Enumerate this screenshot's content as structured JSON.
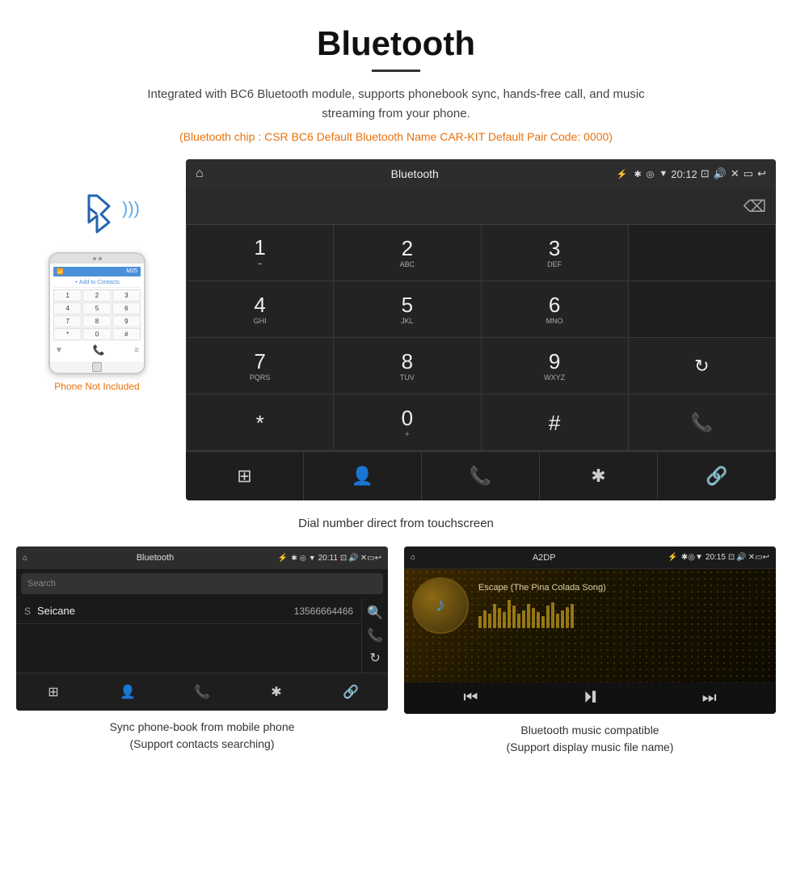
{
  "header": {
    "title": "Bluetooth",
    "subtitle": "Integrated with BC6 Bluetooth module, supports phonebook sync, hands-free call, and music streaming from your phone.",
    "info": "(Bluetooth chip : CSR BC6    Default Bluetooth Name CAR-KIT    Default Pair Code: 0000)"
  },
  "phone_label": "Phone Not Included",
  "dialpad": {
    "screen_title": "Bluetooth",
    "status_time": "20:12",
    "keys": [
      {
        "num": "1",
        "letters": "⌁"
      },
      {
        "num": "2",
        "letters": "ABC"
      },
      {
        "num": "3",
        "letters": "DEF"
      },
      {
        "num": "",
        "letters": "",
        "empty": true
      },
      {
        "num": "4",
        "letters": "GHI"
      },
      {
        "num": "5",
        "letters": "JKL"
      },
      {
        "num": "6",
        "letters": "MNO"
      },
      {
        "num": "",
        "letters": "",
        "empty": true
      },
      {
        "num": "7",
        "letters": "PQRS"
      },
      {
        "num": "8",
        "letters": "TUV"
      },
      {
        "num": "9",
        "letters": "WXYZ"
      },
      {
        "num": "",
        "letters": "reload",
        "special": "reload"
      },
      {
        "num": "*",
        "letters": ""
      },
      {
        "num": "0",
        "letters": "+"
      },
      {
        "num": "#",
        "letters": ""
      },
      {
        "num": "",
        "letters": "call",
        "special": "green_call"
      }
    ],
    "bottom_icons": [
      "grid",
      "person",
      "phone",
      "bluetooth",
      "link"
    ]
  },
  "caption_dial": "Dial number direct from touchscreen",
  "phonebook": {
    "screen_title": "Bluetooth",
    "status_time": "20:11",
    "search_placeholder": "Search",
    "contact_name": "Seicane",
    "contact_number": "13566664466",
    "contact_letter": "S",
    "side_icons": [
      "search",
      "phone",
      "reload"
    ],
    "bottom_icons": [
      "grid",
      "person",
      "phone",
      "bluetooth",
      "link"
    ]
  },
  "caption_pb_title": "Sync phone-book from mobile phone",
  "caption_pb_sub": "(Support contacts searching)",
  "music": {
    "screen_title": "A2DP",
    "status_time": "20:15",
    "song_title": "Escape (The Pina Colada Song)",
    "waveform_heights": [
      15,
      22,
      18,
      30,
      25,
      20,
      35,
      28,
      18,
      22,
      30,
      25,
      20,
      15,
      28,
      32,
      18,
      22,
      26,
      30
    ]
  },
  "caption_music_title": "Bluetooth music compatible",
  "caption_music_sub": "(Support display music file name)"
}
